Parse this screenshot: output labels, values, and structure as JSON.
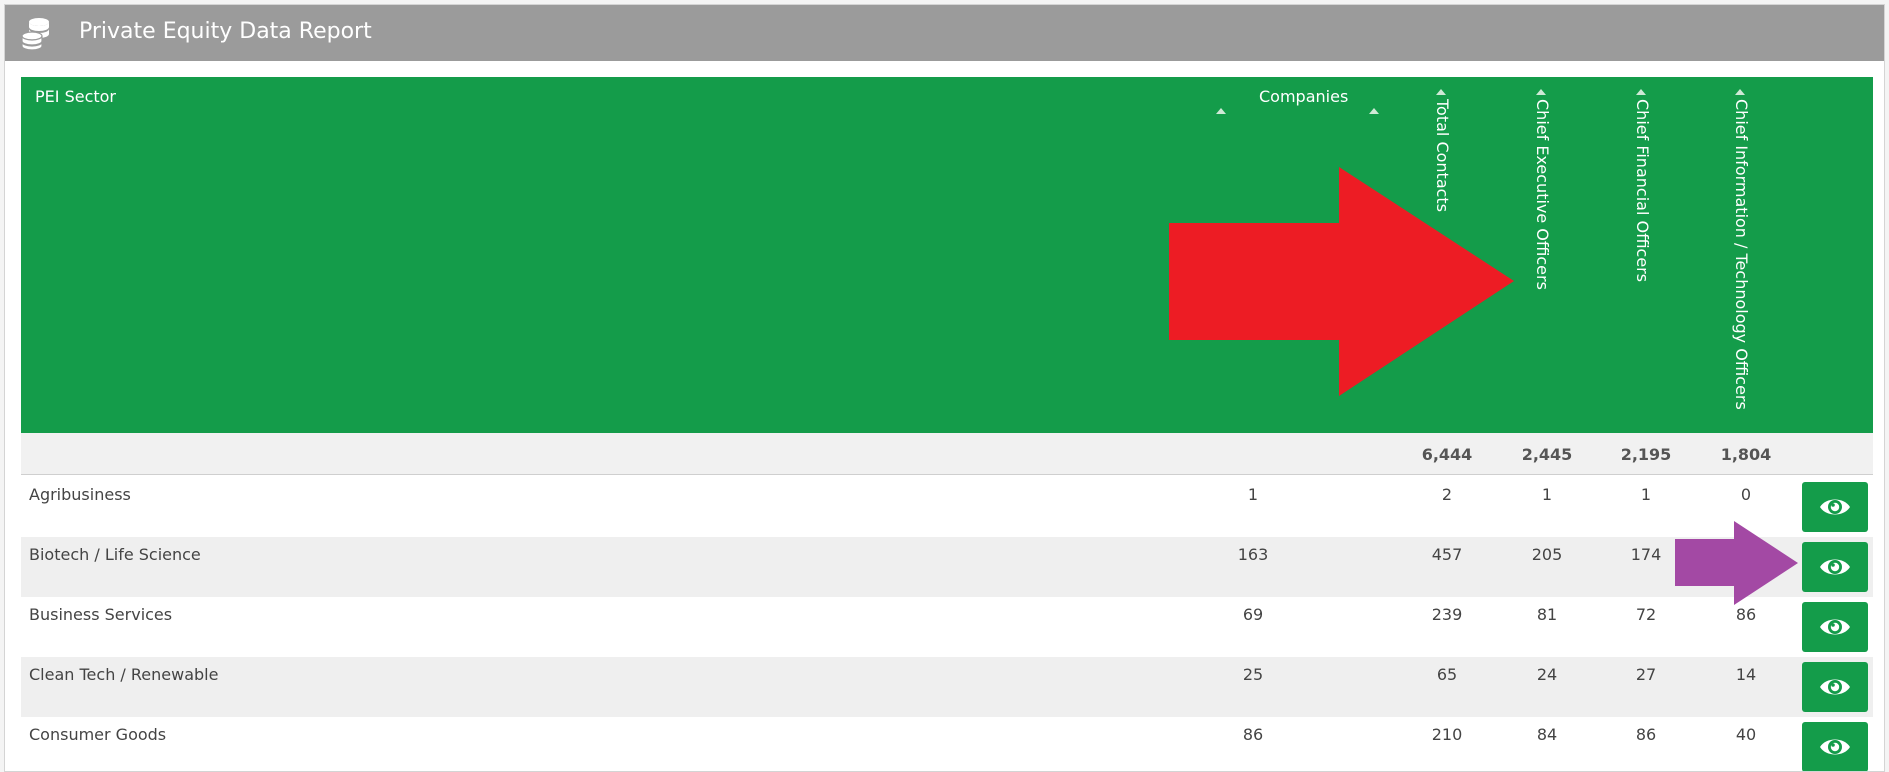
{
  "header": {
    "title": "Private Equity Data Report",
    "icon": "database-coins-icon"
  },
  "table": {
    "columns": {
      "sector": "PEI Sector",
      "companies": "Companies",
      "total_contacts": "Total Contacts",
      "ceo": "Chief Executive Officers",
      "cfo": "Chief Financial Officers",
      "cio": "Chief Information / Technology Officers"
    },
    "totals": {
      "total_contacts": "6,444",
      "ceo": "2,445",
      "cfo": "2,195",
      "cio": "1,804"
    },
    "rows": [
      {
        "sector": "Agribusiness",
        "companies": "1",
        "total_contacts": "2",
        "ceo": "1",
        "cfo": "1",
        "cio": "0"
      },
      {
        "sector": "Biotech / Life Science",
        "companies": "163",
        "total_contacts": "457",
        "ceo": "205",
        "cfo": "174",
        "cio": ""
      },
      {
        "sector": "Business Services",
        "companies": "69",
        "total_contacts": "239",
        "ceo": "81",
        "cfo": "72",
        "cio": "86"
      },
      {
        "sector": "Clean Tech / Renewable",
        "companies": "25",
        "total_contacts": "65",
        "ceo": "24",
        "cfo": "27",
        "cio": "14"
      },
      {
        "sector": "Consumer Goods",
        "companies": "86",
        "total_contacts": "210",
        "ceo": "84",
        "cfo": "86",
        "cio": "40"
      }
    ],
    "row_action_icon": "eye-icon"
  },
  "annotations": {
    "red_arrow_color": "#ed1c24",
    "purple_arrow_color": "#a349a4"
  },
  "colors": {
    "header_bar": "#9b9b9b",
    "table_header": "#149c4a",
    "button": "#149c4a"
  }
}
